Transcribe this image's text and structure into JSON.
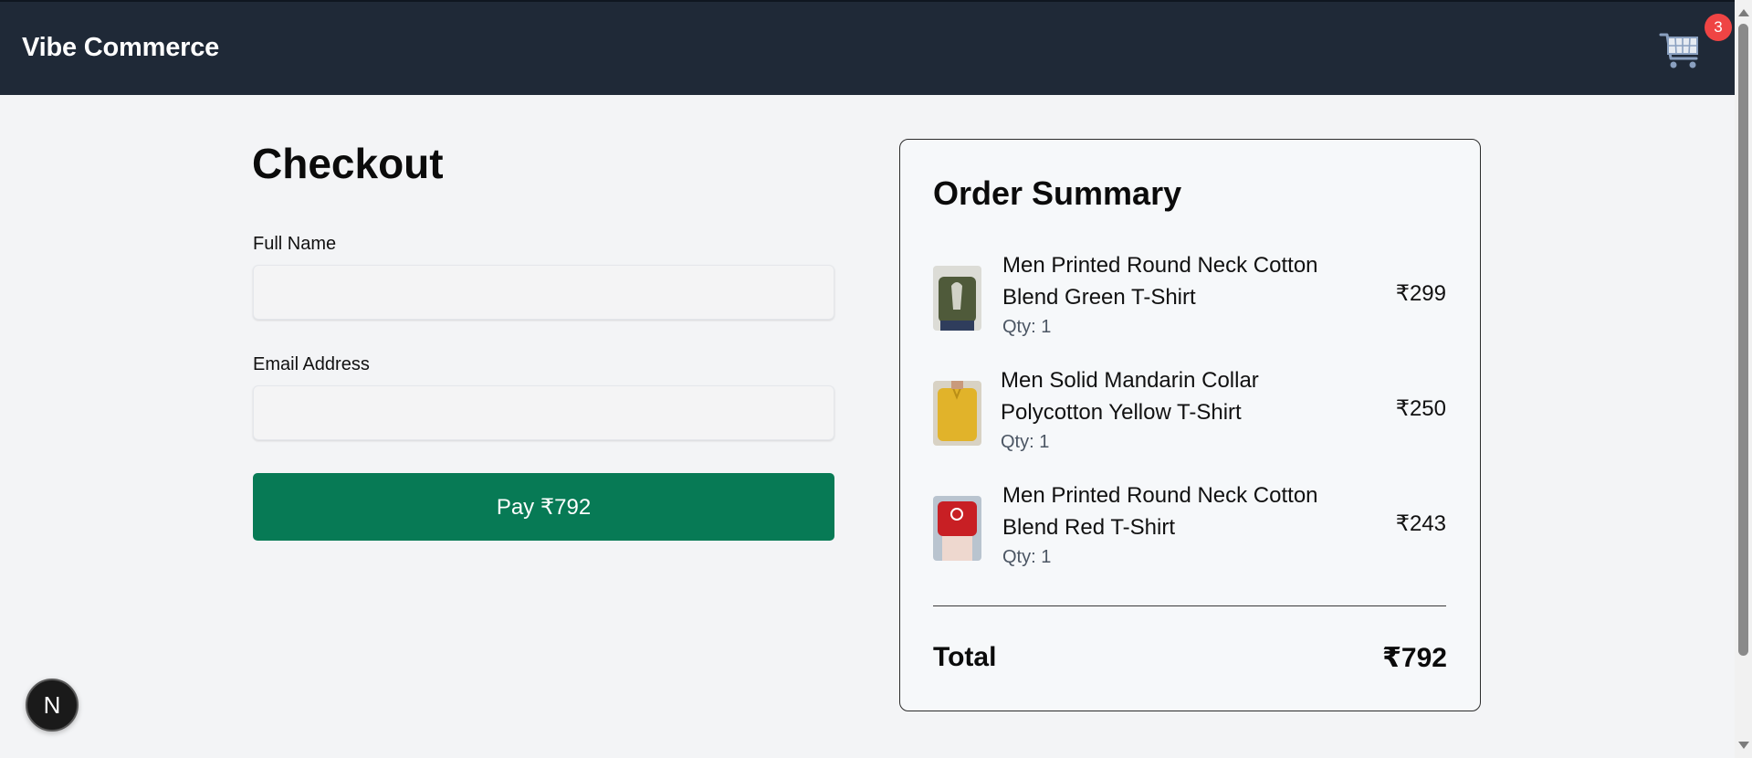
{
  "header": {
    "brand": "Vibe Commerce",
    "cart_count": "3",
    "cart_icon": "shopping-cart-icon"
  },
  "checkout": {
    "title": "Checkout",
    "full_name_label": "Full Name",
    "full_name_value": "",
    "email_label": "Email Address",
    "email_value": "",
    "pay_button": "Pay ₹792"
  },
  "summary": {
    "title": "Order Summary",
    "items": [
      {
        "name": "Men Printed Round Neck Cotton Blend Green T-Shirt",
        "qty": "Qty: 1",
        "price": "₹299",
        "thumb_color": "#4f5a3a"
      },
      {
        "name": "Men Solid Mandarin Collar Polycotton Yellow T-Shirt",
        "qty": "Qty: 1",
        "price": "₹250",
        "thumb_color": "#e1b32a"
      },
      {
        "name": "Men Printed Round Neck Cotton Blend Red T-Shirt",
        "qty": "Qty: 1",
        "price": "₹243",
        "thumb_color": "#c81f24"
      }
    ],
    "total_label": "Total",
    "total_value": "₹792"
  },
  "dev_indicator": {
    "label": "N",
    "icon": "nextjs-icon"
  },
  "colors": {
    "navbar": "#1f2937",
    "pay_button": "#077a55",
    "badge": "#ef4444",
    "background": "#f3f4f6"
  }
}
